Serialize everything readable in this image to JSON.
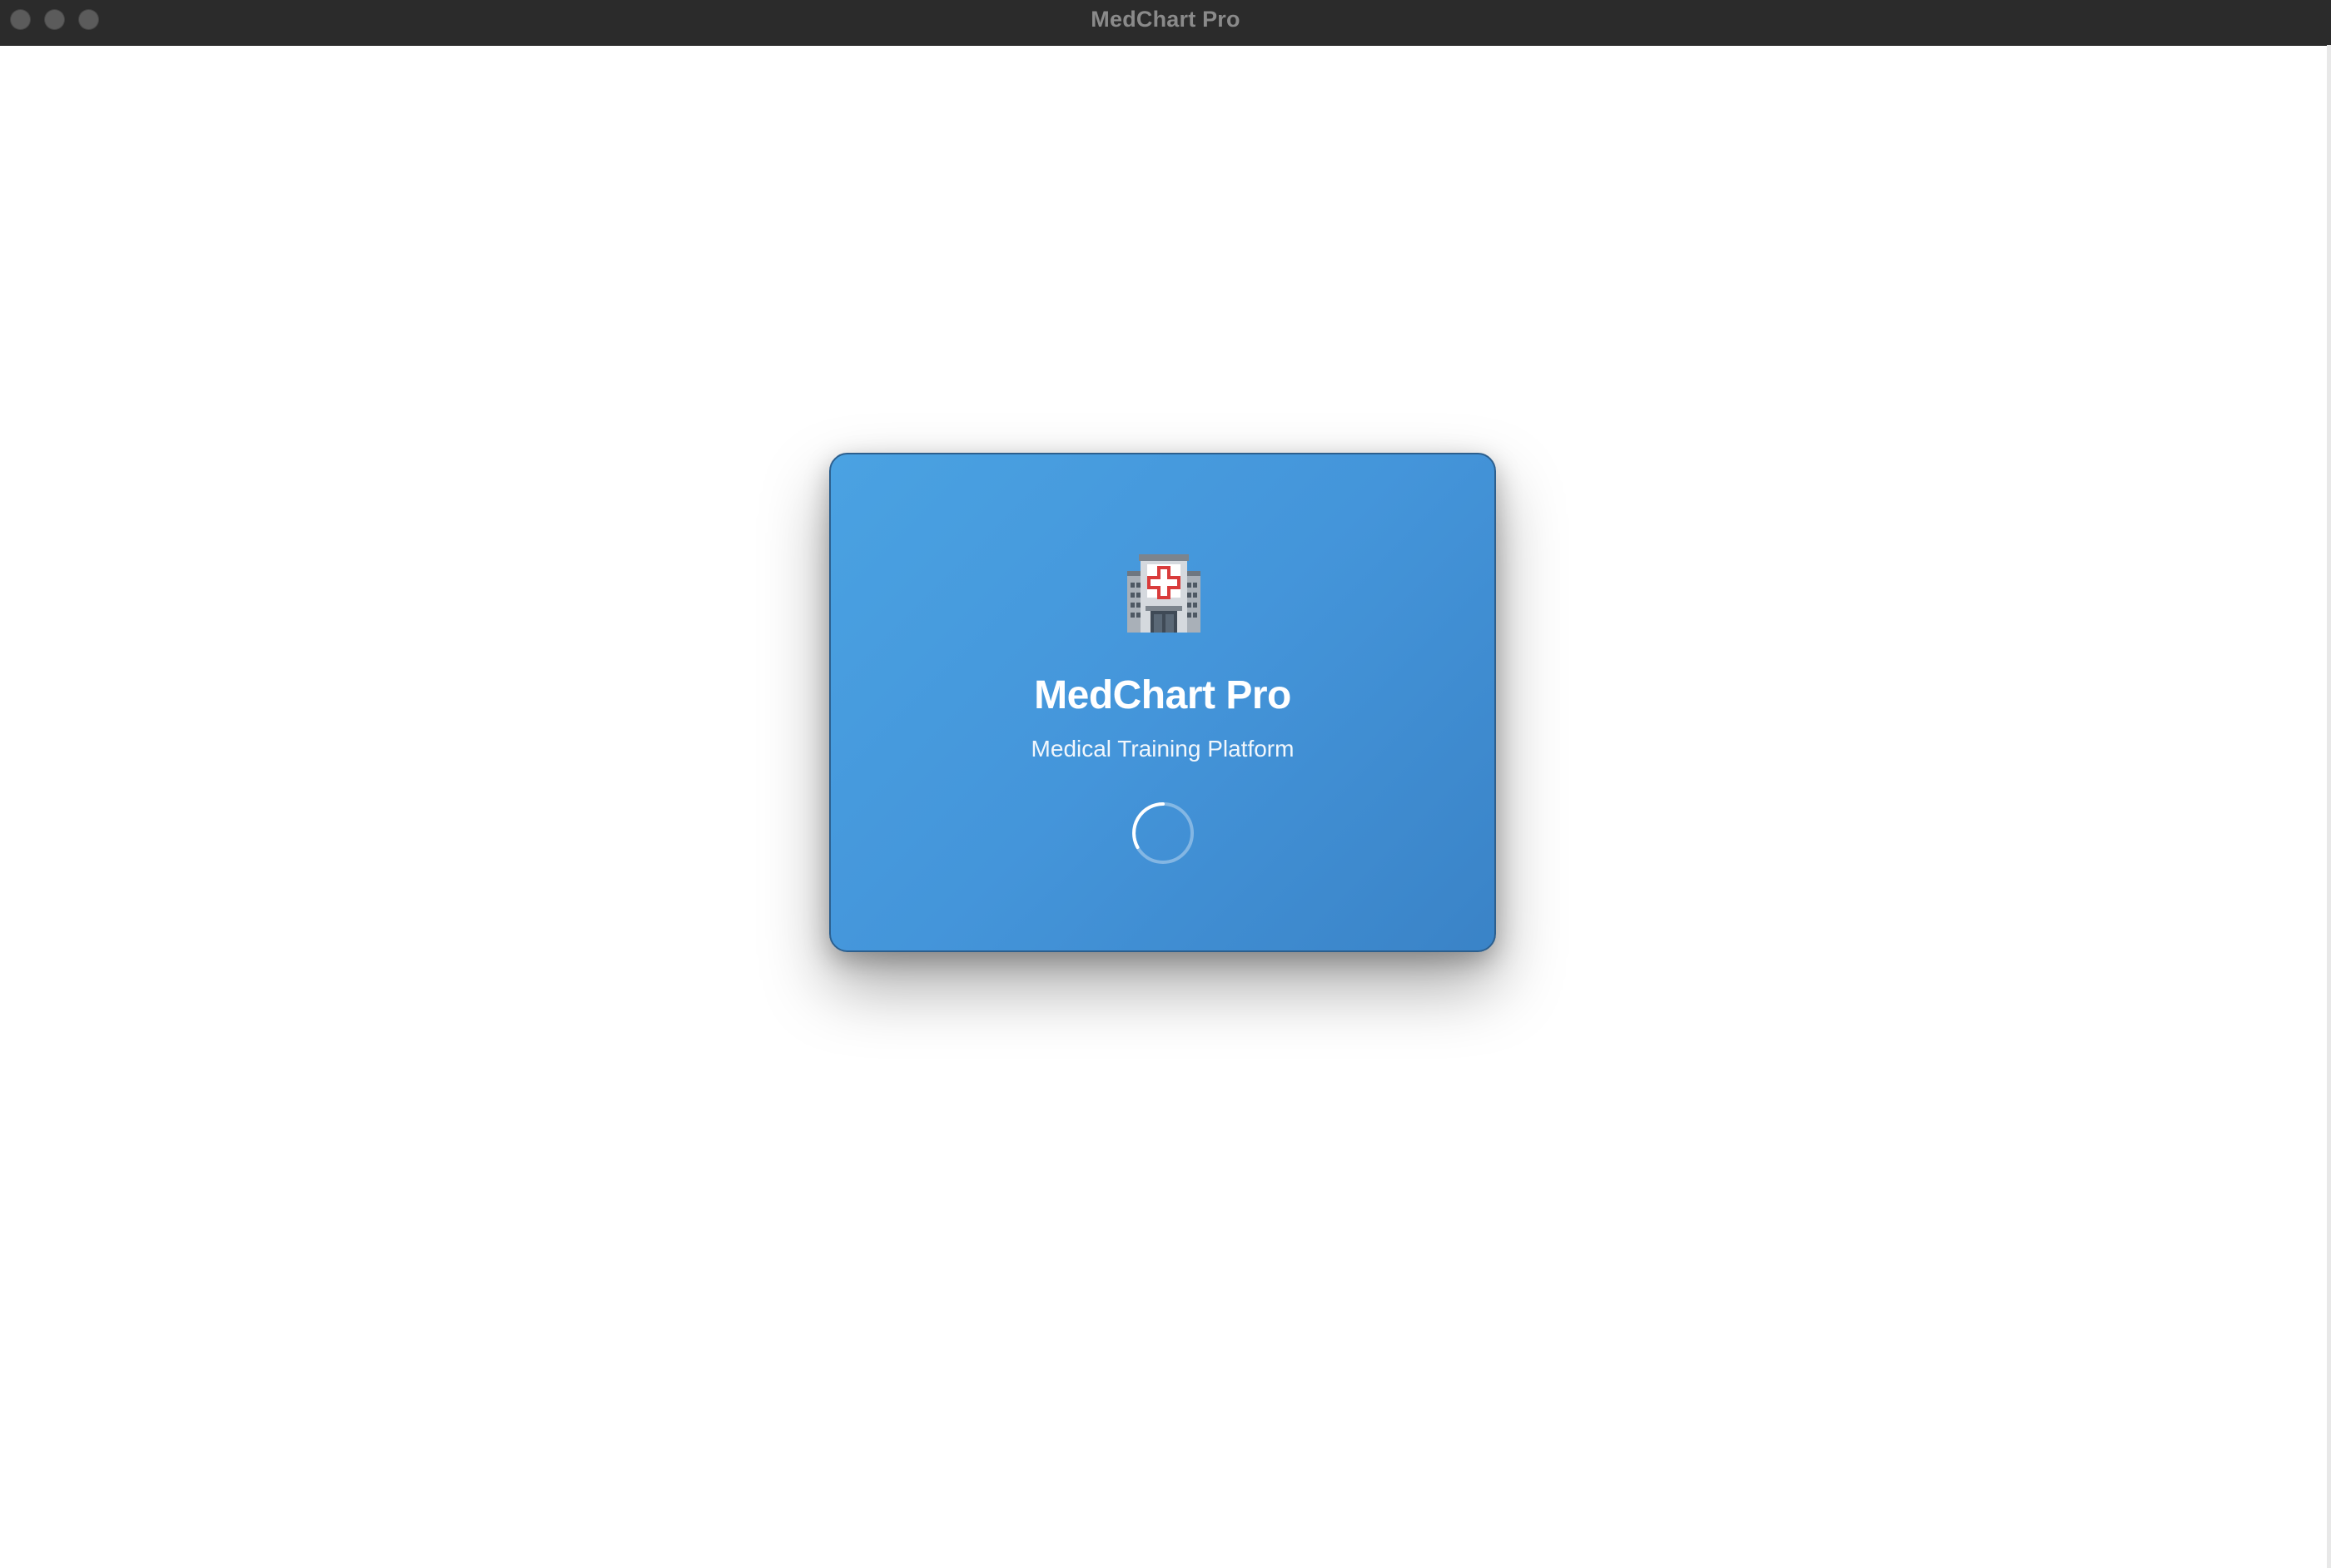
{
  "window": {
    "title": "MedChart Pro"
  },
  "splash": {
    "app_name": "MedChart Pro",
    "subtitle": "Medical Training Platform",
    "icon": "hospital-icon",
    "loading_indicator": "loading-spinner-icon"
  },
  "colors": {
    "titlebar": "#2b2b2b",
    "card_gradient_start": "#4aa2e2",
    "card_gradient_end": "#3a83c7",
    "text": "#ffffff"
  }
}
